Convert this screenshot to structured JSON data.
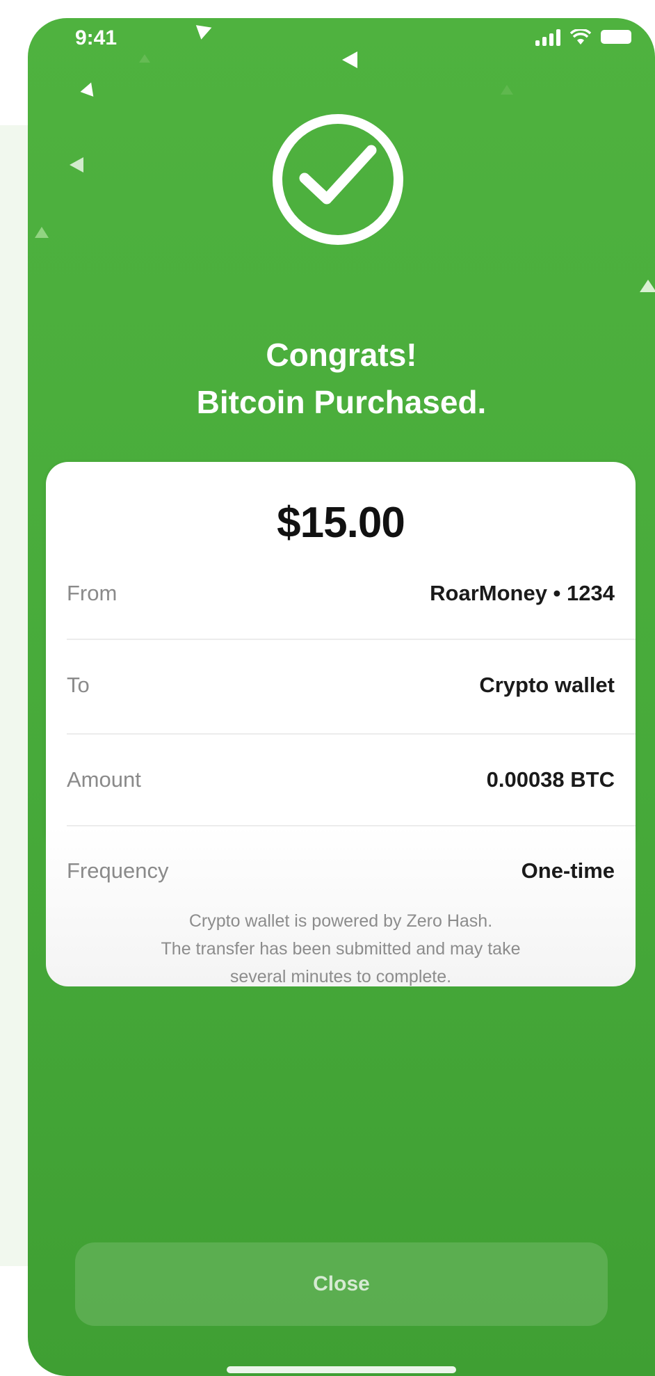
{
  "status_bar": {
    "time": "9:41"
  },
  "success_icon": "check-circle-icon",
  "headline": {
    "line1": "Congrats!",
    "line2": "Bitcoin Purchased."
  },
  "receipt": {
    "total": "$15.00",
    "rows": [
      {
        "label": "From",
        "value": "RoarMoney • 1234"
      },
      {
        "label": "To",
        "value": "Crypto wallet"
      },
      {
        "label": "Amount",
        "value": "0.00038 BTC"
      },
      {
        "label": "Frequency",
        "value": "One-time"
      }
    ],
    "note_lines": [
      "Crypto wallet is powered by Zero Hash.",
      "The transfer has been submitted and may take",
      "several minutes to complete."
    ]
  },
  "actions": {
    "close_label": "Close"
  },
  "colors": {
    "brand_green": "#4fb23f",
    "card": "#ffffff",
    "label_gray": "#8a8a8a"
  }
}
